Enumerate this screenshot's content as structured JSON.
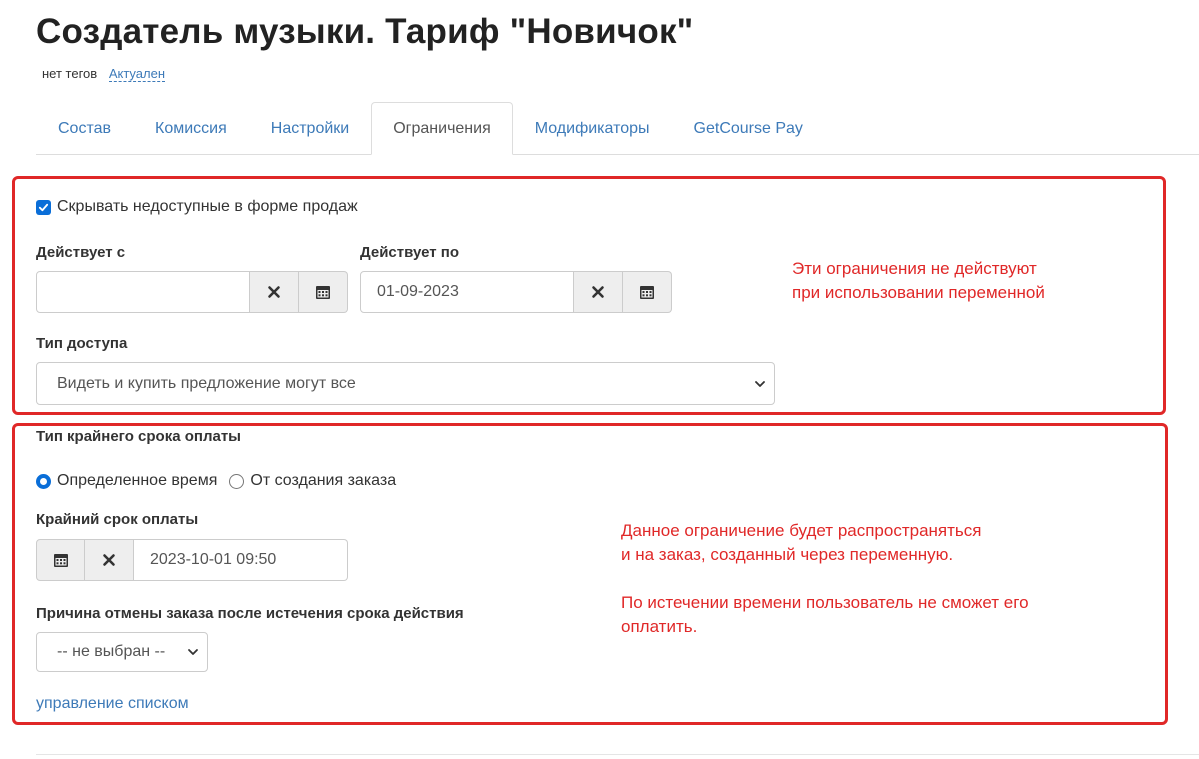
{
  "header": {
    "title": "Создатель музыки. Тариф \"Новичок\"",
    "tags_text": "нет тегов",
    "status_link": "Актуален"
  },
  "tabs": [
    {
      "label": "Состав",
      "active": false
    },
    {
      "label": "Комиссия",
      "active": false
    },
    {
      "label": "Настройки",
      "active": false
    },
    {
      "label": "Ограничения",
      "active": true
    },
    {
      "label": "Модификаторы",
      "active": false
    },
    {
      "label": "GetCourse Pay",
      "active": false
    }
  ],
  "restrictions": {
    "hide_unavailable_label": "Скрывать недоступные в форме продаж",
    "hide_unavailable_checked": true,
    "valid_from": {
      "label": "Действует с",
      "value": ""
    },
    "valid_to": {
      "label": "Действует по",
      "value": "01-09-2023"
    },
    "access_type": {
      "label": "Тип доступа",
      "selected": "Видеть и купить предложение могут все"
    },
    "note": [
      "Эти ограничения не действуют",
      "при использовании переменной"
    ]
  },
  "payment_deadline": {
    "type_label": "Тип крайнего срока оплаты",
    "options": [
      {
        "label": "Определенное время",
        "selected": true
      },
      {
        "label": "От создания заказа",
        "selected": false
      }
    ],
    "deadline_label": "Крайний срок оплаты",
    "deadline_value": "2023-10-01 09:50",
    "cancel_reason_label": "Причина отмены заказа после истечения срока действия",
    "cancel_reason_selected": "-- не выбран --",
    "manage_list_link": "управление списком",
    "note": [
      "Данное ограничение будет распространяться",
      "и на заказ, созданный через переменную.",
      "",
      "По истечении времени пользователь не сможет его",
      "оплатить."
    ]
  },
  "colors": {
    "link": "#3d7ab8",
    "annotation_red": "#e02828",
    "checkbox_blue": "#0a6ed8"
  }
}
